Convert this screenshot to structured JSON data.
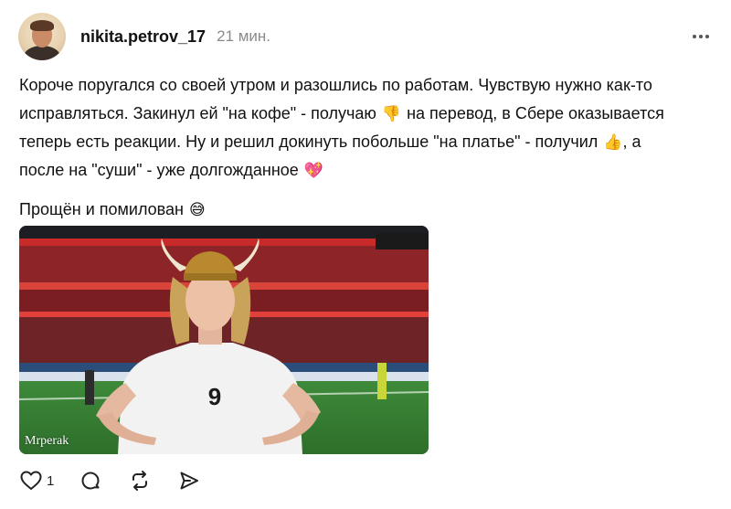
{
  "post": {
    "author": "nikita.petrov_17",
    "time": "21 мин.",
    "avatar_icon": "user-avatar-photo",
    "text": {
      "line1": "Короче поругался со своей утром и разошлись по работам. Чувствую нужно как-то",
      "line2a": "исправляться. Закинул ей \"на кофе\" - получаю",
      "line2b": "на перевод, в Сбере оказывается",
      "line3a": "теперь есть реакции. Ну и решил докинуть побольше \"на платье\" - получил",
      "line3b": ", а",
      "line4": "после на \"суши\" - уже долгожданное"
    },
    "text2": "Прощён и помилован",
    "emoji": {
      "thumbs_down": "👎",
      "thumbs_up": "👍",
      "heart": "💖",
      "sweat_smile": "😅"
    },
    "media": {
      "watermark": "Mrperak",
      "jersey_number": "9"
    },
    "likes_count": "1"
  },
  "colors": {
    "text": "#111111",
    "muted": "#8a8a8a",
    "icon": "#222222"
  }
}
